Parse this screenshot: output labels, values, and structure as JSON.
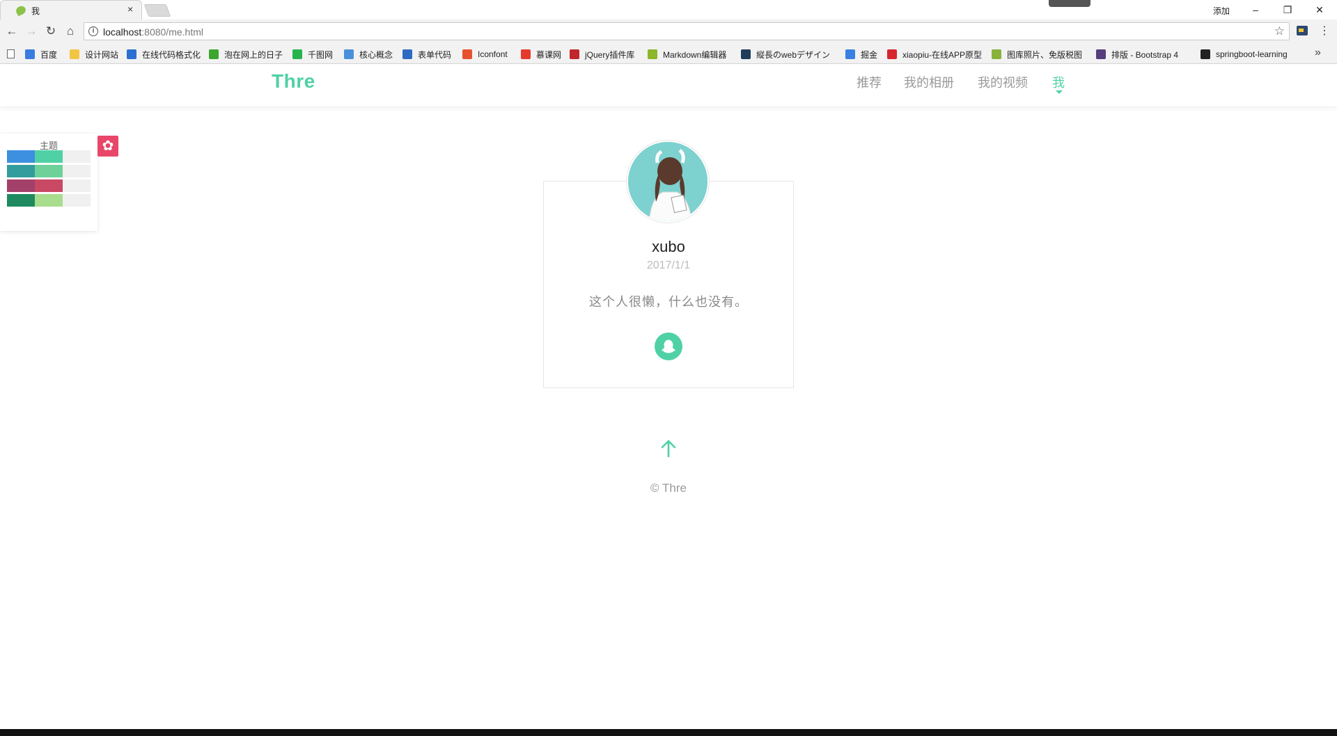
{
  "browser": {
    "tab_title": "我",
    "tab_close": "×",
    "user_label": "添加",
    "window_buttons": {
      "minimize": "–",
      "restore": "❐",
      "close": "✕"
    },
    "url_host": "localhost",
    "url_rest": ":8080/me.html",
    "bookmarks": [
      {
        "label": "百度",
        "icon": "paw-icon",
        "color": "#3a7be0"
      },
      {
        "label": "设计网站",
        "icon": "folder-icon",
        "color": "#f3c544"
      },
      {
        "label": "在线代码格式化",
        "icon": "c-icon",
        "color": "#2b6fd1"
      },
      {
        "label": "泡在网上的日子",
        "icon": "j-icon",
        "color": "#3ba52e"
      },
      {
        "label": "千图网",
        "icon": "qiantu-icon",
        "color": "#27b34d"
      },
      {
        "label": "核心概念",
        "icon": "dot-icon",
        "color": "#4a90d9"
      },
      {
        "label": "表单代码",
        "icon": "form-icon",
        "color": "#2d6bc2"
      },
      {
        "label": "Iconfont",
        "icon": "iconfont-icon",
        "color": "#e6512f"
      },
      {
        "label": "慕课网",
        "icon": "fire-icon",
        "color": "#e43b2c"
      },
      {
        "label": "jQuery插件库",
        "icon": "jquery-icon",
        "color": "#c0262b"
      },
      {
        "label": "Markdown编辑器",
        "icon": "m-icon",
        "color": "#8db62a"
      },
      {
        "label": "縦長のwebデザイン",
        "icon": "grid-icon",
        "color": "#1f3d5a"
      },
      {
        "label": "掘金",
        "icon": "juejin-icon",
        "color": "#3a80e3"
      },
      {
        "label": "xiaopiu-在线APP原型",
        "icon": "piu-icon",
        "color": "#d8242c"
      },
      {
        "label": "图库照片、免版税图",
        "icon": "photo-icon",
        "color": "#8ab23a"
      },
      {
        "label": "排版 - Bootstrap 4",
        "icon": "bootstrap-icon",
        "color": "#563d7c"
      },
      {
        "label": "springboot-learning",
        "icon": "github-icon",
        "color": "#222222"
      }
    ],
    "bookmarks_more": "»"
  },
  "site": {
    "logo": "Thre",
    "accent": "#4fd1a5",
    "nav": [
      {
        "label": "推荐"
      },
      {
        "label": "我的相册"
      },
      {
        "label": "我的视频"
      },
      {
        "label": "我",
        "active": true
      }
    ]
  },
  "theme_panel": {
    "title": "主题",
    "themes": [
      {
        "primary": "#3d90e0",
        "secondary": "#4fd1a5"
      },
      {
        "primary": "#339d9d",
        "secondary": "#6fd19a"
      },
      {
        "primary": "#a34069",
        "secondary": "#c94863"
      },
      {
        "primary": "#1f8a60",
        "secondary": "#a8dd8e"
      }
    ],
    "gear_color": "#e8476a"
  },
  "profile": {
    "username": "xubo",
    "joined": "2017/1/1",
    "bio": "这个人很懒，什么也没有。"
  },
  "footer": {
    "copyright": "© Thre"
  }
}
